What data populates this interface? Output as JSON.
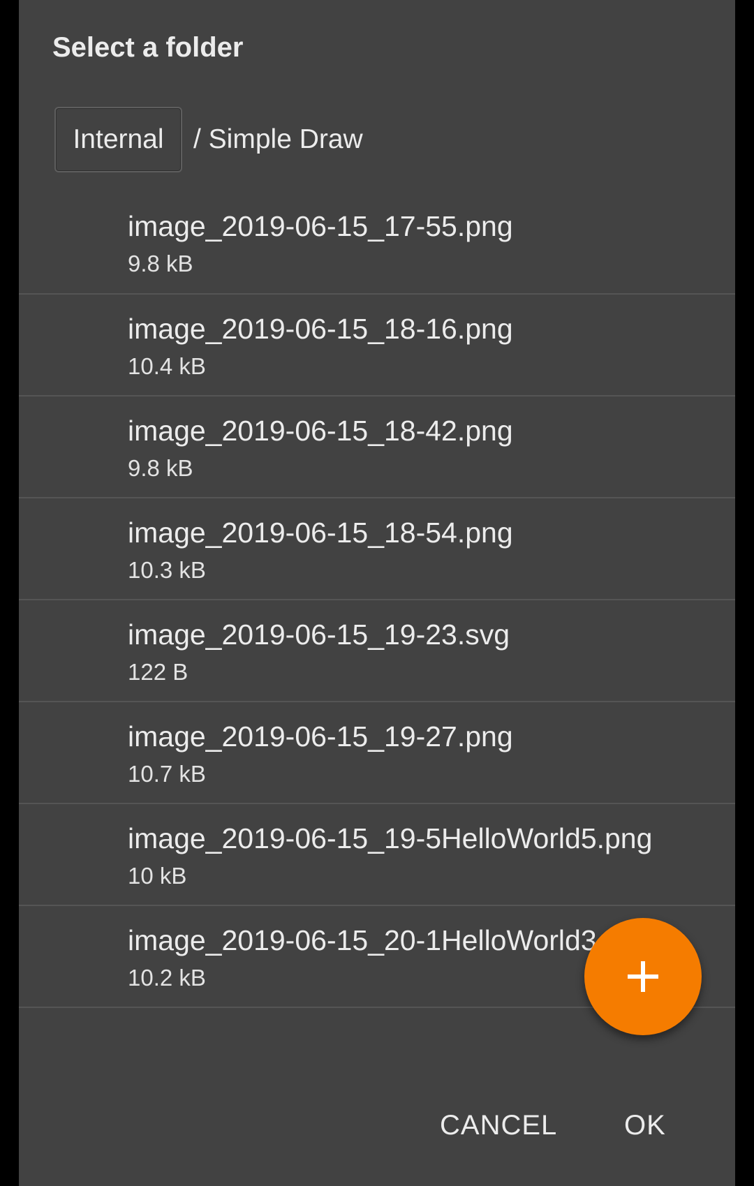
{
  "dialog": {
    "title": "Select a folder",
    "breadcrumb": {
      "root": "Internal",
      "path": "/ Simple Draw"
    },
    "files": [
      {
        "name": "image_2019-06-15_17-55.png",
        "size": "9.8 kB"
      },
      {
        "name": "image_2019-06-15_18-16.png",
        "size": "10.4 kB"
      },
      {
        "name": "image_2019-06-15_18-42.png",
        "size": "9.8 kB"
      },
      {
        "name": "image_2019-06-15_18-54.png",
        "size": "10.3 kB"
      },
      {
        "name": "image_2019-06-15_19-23.svg",
        "size": "122 B"
      },
      {
        "name": "image_2019-06-15_19-27.png",
        "size": "10.7 kB"
      },
      {
        "name": "image_2019-06-15_19-5HelloWorld5.png",
        "size": "10 kB"
      },
      {
        "name": "image_2019-06-15_20-1HelloWorld3",
        "size": "10.2 kB"
      }
    ],
    "fab": {
      "icon": "plus-icon",
      "color": "#f57c00"
    },
    "actions": {
      "cancel_label": "CANCEL",
      "ok_label": "OK"
    }
  },
  "colors": {
    "dialog_background": "#424242",
    "accent": "#f57c00",
    "text": "#ececec"
  }
}
